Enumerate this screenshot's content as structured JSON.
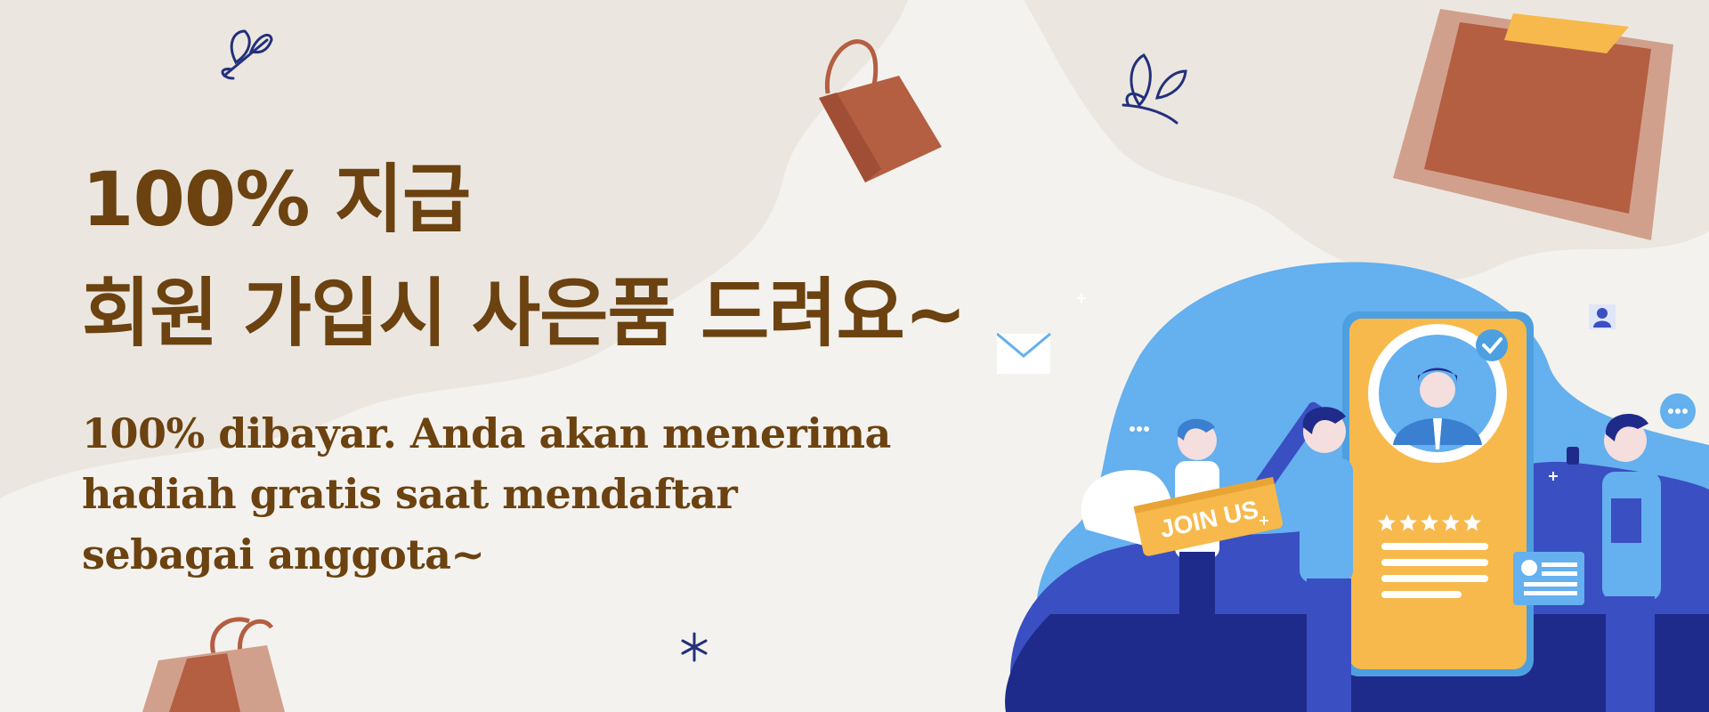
{
  "headline": {
    "line1": "100% 지급",
    "line2": "회원 가입시 사은품 드려요~"
  },
  "subline": {
    "line1": "100% dibayar. Anda akan menerima",
    "line2": "hadiah gratis saat mendaftar",
    "line3": "sebagai anggota~"
  },
  "badge": {
    "label": "JOIN US"
  },
  "rating": {
    "value": 5,
    "max": 5
  },
  "colors": {
    "background": "#f4f2ee",
    "text": "#6b4210",
    "brown_bag": "#b45e42",
    "pale_bag": "#d1a08c",
    "blob_light": "#65b0ee",
    "blob_dark": "#3a4fc2",
    "navy": "#1f2b8a",
    "yellow": "#f7b94b",
    "leaf_navy": "#23307a"
  }
}
